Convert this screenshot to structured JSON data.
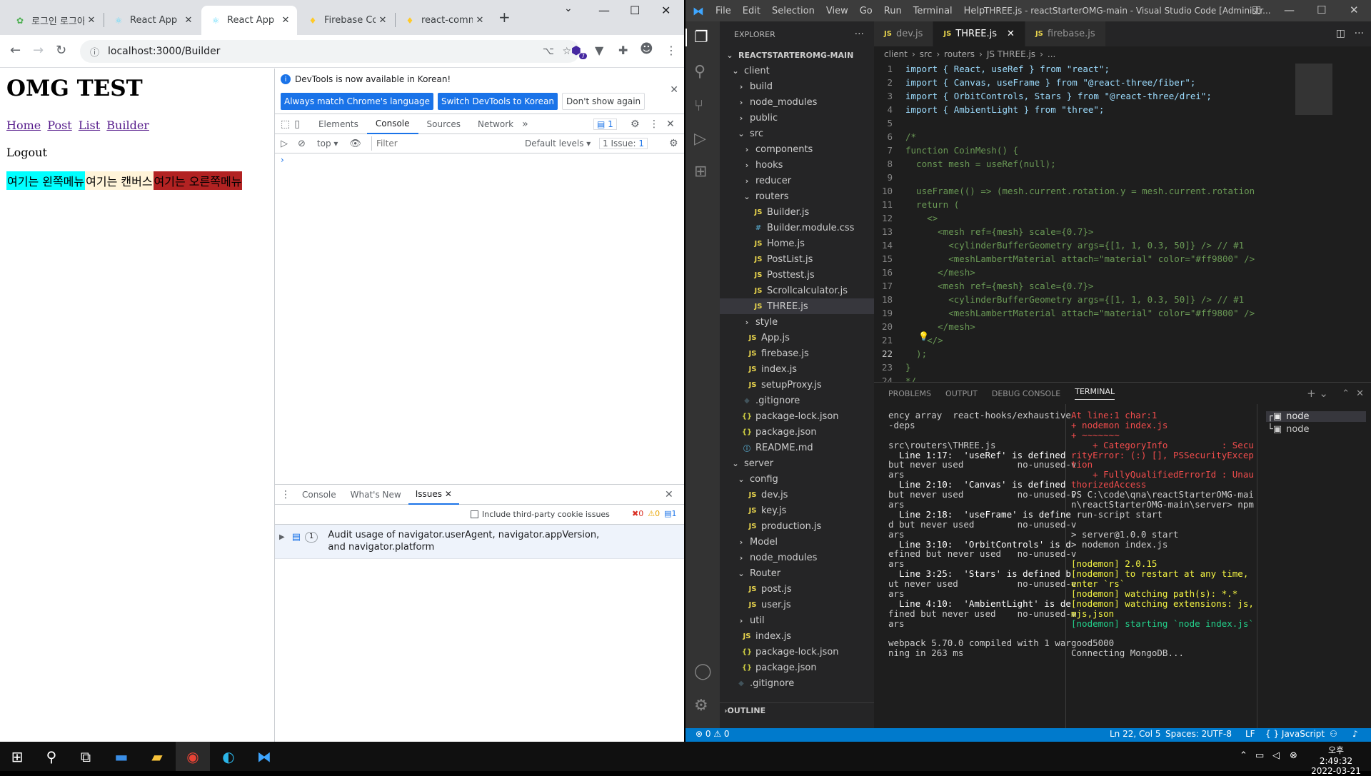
{
  "chrome": {
    "tabs": [
      {
        "title": "로그인 로그아웃",
        "favicon": "firebase-flame"
      },
      {
        "title": "React App",
        "favicon": "react-logo"
      },
      {
        "title": "React App",
        "favicon": "react-logo"
      },
      {
        "title": "Firebase Con",
        "favicon": "firebase-flame"
      },
      {
        "title": "react-commu",
        "favicon": "firebase-flame"
      }
    ],
    "url": "localhost:3000/Builder",
    "extension_badge": "7"
  },
  "page": {
    "heading": "OMG TEST",
    "links": [
      "Home",
      "Post",
      "List",
      "Builder"
    ],
    "logout": "Logout",
    "left_menu": "여기는 왼쪽메뉴",
    "canvas": "여기는 캔버스",
    "right_menu": "여기는 오른쪽메뉴",
    "colors": {
      "left": "#00ffff",
      "canvas": "#fff4d9",
      "right": "#b22222"
    }
  },
  "devtools": {
    "info": "DevTools is now available in Korean!",
    "btn_match": "Always match Chrome's language",
    "btn_switch": "Switch DevTools to Korean",
    "btn_dont": "Don't show again",
    "tabs": [
      "Elements",
      "Console",
      "Sources",
      "Network"
    ],
    "tab_badge": "1",
    "context": "top",
    "filter_placeholder": "Filter",
    "levels": "Default levels",
    "issue_count": "1 Issue:",
    "issue_num": "1",
    "drawer_tabs": [
      "Console",
      "What's New",
      "Issues"
    ],
    "third_party": "Include third-party cookie issues",
    "counts": {
      "errors": "0",
      "warnings": "0",
      "info": "1"
    },
    "issue_text": "Audit usage of navigator.userAgent, navigator.appVersion, and navigator.platform",
    "issue_badge": "1"
  },
  "vscode": {
    "menu": [
      "File",
      "Edit",
      "Selection",
      "View",
      "Go",
      "Run",
      "Terminal",
      "Help"
    ],
    "title": "THREE.js - reactStarterOMG-main - Visual Studio Code [Administr...",
    "explorer_label": "EXPLORER",
    "root": "REACTSTARTEROMG-MAIN",
    "tree": [
      {
        "label": "client",
        "indent": 1,
        "kind": "open"
      },
      {
        "label": "build",
        "indent": 2,
        "kind": "closed"
      },
      {
        "label": "node_modules",
        "indent": 2,
        "kind": "closed"
      },
      {
        "label": "public",
        "indent": 2,
        "kind": "closed"
      },
      {
        "label": "src",
        "indent": 2,
        "kind": "open"
      },
      {
        "label": "components",
        "indent": 3,
        "kind": "closed"
      },
      {
        "label": "hooks",
        "indent": 3,
        "kind": "closed"
      },
      {
        "label": "reducer",
        "indent": 3,
        "kind": "closed"
      },
      {
        "label": "routers",
        "indent": 3,
        "kind": "open"
      },
      {
        "label": "Builder.js",
        "indent": 4,
        "kind": "js"
      },
      {
        "label": "Builder.module.css",
        "indent": 4,
        "kind": "css"
      },
      {
        "label": "Home.js",
        "indent": 4,
        "kind": "js"
      },
      {
        "label": "PostList.js",
        "indent": 4,
        "kind": "js"
      },
      {
        "label": "Posttest.js",
        "indent": 4,
        "kind": "js"
      },
      {
        "label": "Scrollcalculator.js",
        "indent": 4,
        "kind": "js"
      },
      {
        "label": "THREE.js",
        "indent": 4,
        "kind": "js",
        "selected": true
      },
      {
        "label": "style",
        "indent": 3,
        "kind": "closed"
      },
      {
        "label": "App.js",
        "indent": 3,
        "kind": "js"
      },
      {
        "label": "firebase.js",
        "indent": 3,
        "kind": "js"
      },
      {
        "label": "index.js",
        "indent": 3,
        "kind": "js"
      },
      {
        "label": "setupProxy.js",
        "indent": 3,
        "kind": "js"
      },
      {
        "label": ".gitignore",
        "indent": 2,
        "kind": "git"
      },
      {
        "label": "package-lock.json",
        "indent": 2,
        "kind": "json"
      },
      {
        "label": "package.json",
        "indent": 2,
        "kind": "json"
      },
      {
        "label": "README.md",
        "indent": 2,
        "kind": "md"
      },
      {
        "label": "server",
        "indent": 1,
        "kind": "open"
      },
      {
        "label": "config",
        "indent": 2,
        "kind": "open"
      },
      {
        "label": "dev.js",
        "indent": 3,
        "kind": "js"
      },
      {
        "label": "key.js",
        "indent": 3,
        "kind": "js"
      },
      {
        "label": "production.js",
        "indent": 3,
        "kind": "js"
      },
      {
        "label": "Model",
        "indent": 2,
        "kind": "closed"
      },
      {
        "label": "node_modules",
        "indent": 2,
        "kind": "closed"
      },
      {
        "label": "Router",
        "indent": 2,
        "kind": "open"
      },
      {
        "label": "post.js",
        "indent": 3,
        "kind": "js"
      },
      {
        "label": "user.js",
        "indent": 3,
        "kind": "js"
      },
      {
        "label": "util",
        "indent": 2,
        "kind": "closed"
      },
      {
        "label": "index.js",
        "indent": 2,
        "kind": "js"
      },
      {
        "label": "package-lock.json",
        "indent": 2,
        "kind": "json"
      },
      {
        "label": "package.json",
        "indent": 2,
        "kind": "json"
      },
      {
        "label": ".gitignore",
        "indent": 1,
        "kind": "git"
      }
    ],
    "outline": "OUTLINE",
    "editor_tabs": [
      "dev.js",
      "THREE.js",
      "firebase.js"
    ],
    "breadcrumb": [
      "client",
      "src",
      "routers",
      "JS THREE.js",
      "..."
    ],
    "code": [
      "import { React, useRef } from \"react\";",
      "import { Canvas, useFrame } from \"@react-three/fiber\";",
      "import { OrbitControls, Stars } from \"@react-three/drei\";",
      "import { AmbientLight } from \"three\";",
      "",
      "/*",
      "function CoinMesh() {",
      "  const mesh = useRef(null);",
      "",
      "  useFrame(() => (mesh.current.rotation.y = mesh.current.rotation",
      "  return (",
      "    <>",
      "      <mesh ref={mesh} scale={0.7}>",
      "        <cylinderBufferGeometry args={[1, 1, 0.3, 50]} /> // #1",
      "        <meshLambertMaterial attach=\"material\" color=\"#ff9800\" />",
      "      </mesh>",
      "      <mesh ref={mesh} scale={0.7}>",
      "        <cylinderBufferGeometry args={[1, 1, 0.3, 50]} /> // #1",
      "        <meshLambertMaterial attach=\"material\" color=\"#ff9800\" />",
      "      </mesh>",
      "    </>",
      "  );",
      "}",
      "*/"
    ],
    "current_line": 22,
    "panel_tabs": [
      "PROBLEMS",
      "OUTPUT",
      "DEBUG CONSOLE",
      "TERMINAL"
    ],
    "terminal_left": [
      "ency array  react-hooks/exhaustive",
      "-deps",
      "",
      "src\\routers\\THREE.js",
      "  Line 1:17:  'useRef' is defined",
      "but never used          no-unused-v",
      "ars",
      "  Line 2:10:  'Canvas' is defined",
      "but never used          no-unused-v",
      "ars",
      "  Line 2:18:  'useFrame' is define",
      "d but never used        no-unused-v",
      "ars",
      "  Line 3:10:  'OrbitControls' is d",
      "efined but never used   no-unused-v",
      "ars",
      "  Line 3:25:  'Stars' is defined b",
      "ut never used           no-unused-v",
      "ars",
      "  Line 4:10:  'AmbientLight' is de",
      "fined but never used    no-unused-v",
      "ars",
      "",
      "webpack 5.70.0 compiled with 1 war",
      "ning in 263 ms",
      ""
    ],
    "terminal_right": [
      "At line:1 char:1",
      "+ nodemon index.js",
      "+ ~~~~~~~",
      "    + CategoryInfo          : Secu",
      "rityError: (:) [], PSSecurityExcep",
      "tion",
      "    + FullyQualifiedErrorId : Unau",
      "thorizedAccess",
      "PS C:\\code\\qna\\reactStarterOMG-mai",
      "n\\reactStarterOMG-main\\server> npm",
      " run-script start",
      "",
      "> server@1.0.0 start",
      "> nodemon index.js",
      "",
      "[nodemon] 2.0.15",
      "[nodemon] to restart at any time,",
      "enter `rs`",
      "[nodemon] watching path(s): *.*",
      "[nodemon] watching extensions: js,",
      "mjs,json",
      "[nodemon] starting `node index.js`",
      "",
      "good5000",
      "Connecting MongoDB...",
      ""
    ],
    "terminals": [
      "node",
      "node"
    ],
    "status": {
      "problems": "0",
      "warnings": "0",
      "position": "Ln 22, Col 5",
      "spaces": "Spaces: 2",
      "encoding": "UTF-8",
      "eol": "LF",
      "language": "JavaScript"
    }
  },
  "taskbar": {
    "time": "오후 2:49:32",
    "date": "2022-03-21"
  }
}
